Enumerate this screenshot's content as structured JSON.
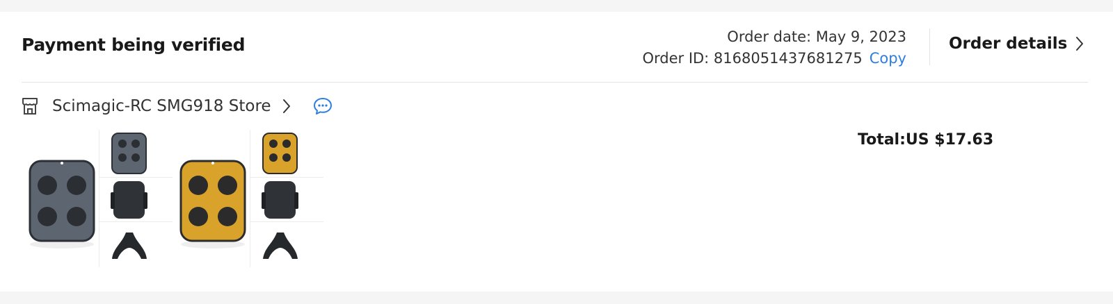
{
  "order": {
    "status": "Payment being verified",
    "date_text": "Order date: May 9, 2023",
    "id_text": "Order ID: 8168051437681275",
    "copy_label": "Copy",
    "details_label": "Order details",
    "total_text": "Total:US $17.63"
  },
  "store": {
    "name": "Scimagic-RC SMG918 Store",
    "icon": "store-icon",
    "chat_icon": "chat-bubble-icon"
  },
  "products": [
    {
      "variant": "gray",
      "color": "#5d6670"
    },
    {
      "variant": "yellow",
      "color": "#d9a22b"
    }
  ],
  "colors": {
    "link": "#2e7de1",
    "page_bg": "#f5f5f5",
    "divider": "#e3e3e3"
  }
}
